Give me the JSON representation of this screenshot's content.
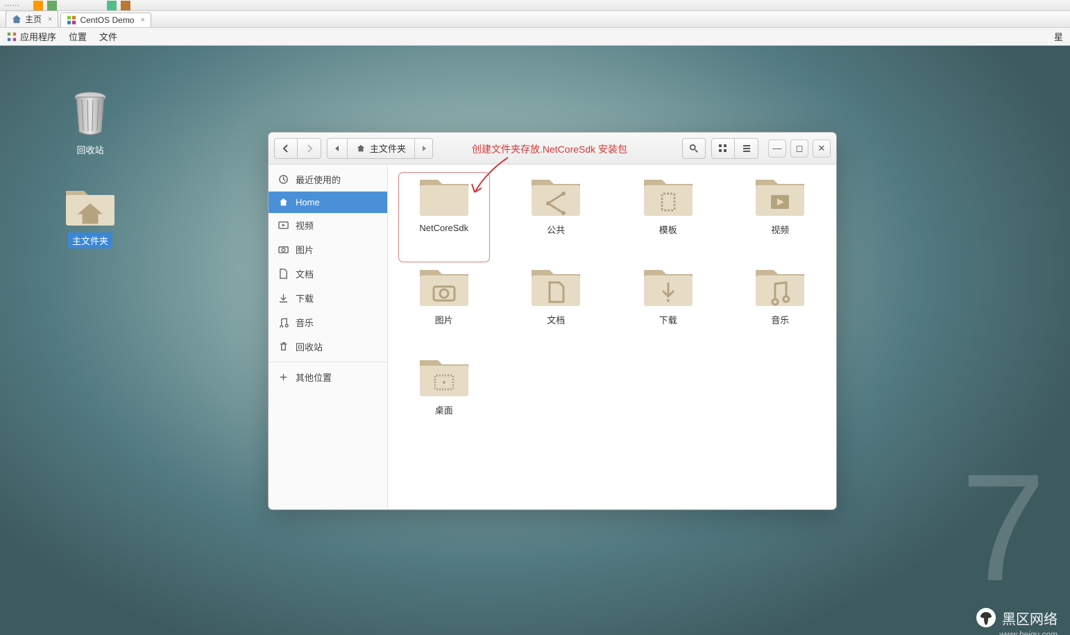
{
  "host_toolbar_hint": "…",
  "tabs": [
    {
      "label": "主页"
    },
    {
      "label": "CentOS Demo"
    }
  ],
  "vm_menubar": {
    "apps": "应用程序",
    "places": "位置",
    "files": "文件",
    "right": "星"
  },
  "desktop": {
    "trash_label": "回收站",
    "home_label": "主文件夹"
  },
  "nautilus": {
    "path_label": "主文件夹",
    "sidebar": {
      "recent": "最近使用的",
      "home": "Home",
      "videos": "视频",
      "pictures": "图片",
      "documents": "文档",
      "downloads": "下载",
      "music": "音乐",
      "trash": "回收站",
      "other": "其他位置"
    },
    "files": [
      {
        "name": "NetCoreSdk",
        "glyph": "none",
        "selected": true
      },
      {
        "name": "公共",
        "glyph": "share"
      },
      {
        "name": "模板",
        "glyph": "template"
      },
      {
        "name": "视频",
        "glyph": "video"
      },
      {
        "name": "图片",
        "glyph": "camera"
      },
      {
        "name": "文档",
        "glyph": "doc"
      },
      {
        "name": "下载",
        "glyph": "download"
      },
      {
        "name": "音乐",
        "glyph": "music"
      },
      {
        "name": "桌面",
        "glyph": "desktop"
      }
    ]
  },
  "annotation": "创建文件夹存放.NetCoreSdk 安装包",
  "watermark": {
    "brand": "黑区网络",
    "url": "www.heiqu.com"
  }
}
